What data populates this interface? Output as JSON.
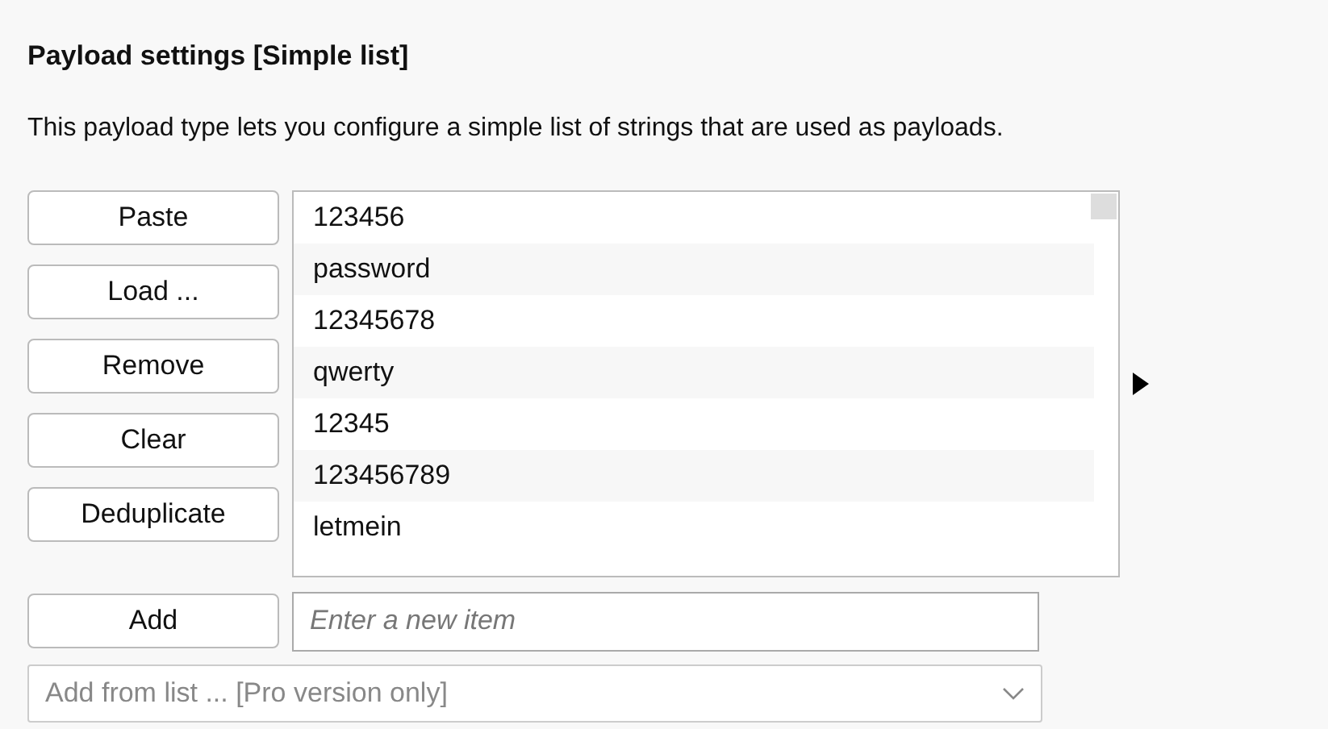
{
  "heading": "Payload settings [Simple list]",
  "description": "This payload type lets you configure a simple list of strings that are used as payloads.",
  "buttons": [
    "Paste",
    "Load ...",
    "Remove",
    "Clear",
    "Deduplicate"
  ],
  "list_items": [
    "123456",
    "password",
    "12345678",
    "qwerty",
    "12345",
    "123456789",
    "letmein"
  ],
  "add_button": "Add",
  "new_item_field": {
    "placeholder": "Enter a new item"
  },
  "add_from_list": {
    "value": "Add from list ... [Pro version only]",
    "disabled": true
  }
}
